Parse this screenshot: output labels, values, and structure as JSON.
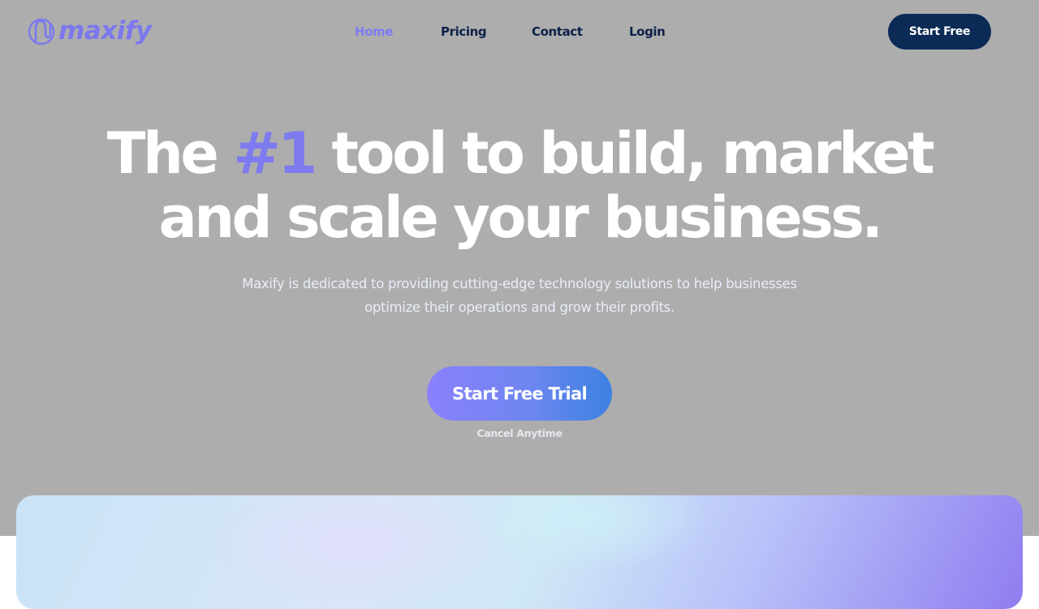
{
  "brand": {
    "name": "maxify",
    "color": "#7b78ee"
  },
  "nav": {
    "items": [
      {
        "label": "Home",
        "active": true
      },
      {
        "label": "Pricing",
        "active": false
      },
      {
        "label": "Contact",
        "active": false
      },
      {
        "label": "Login",
        "active": false
      }
    ],
    "cta_label": "Start Free"
  },
  "hero": {
    "headline_before": "The ",
    "headline_accent": "#1",
    "headline_after": " tool to build, market and scale your business.",
    "subtext": "Maxify is dedicated to providing cutting-edge technology solutions to help businesses optimize their operations and grow their profits.",
    "cta_label": "Start Free Trial",
    "cta_note": "Cancel Anytime"
  },
  "colors": {
    "hero_bg": "#adadad",
    "accent": "#7e7af0",
    "navy": "#0b2a55",
    "text_dark": "#0b2149"
  },
  "icons": {
    "logo": "maxify-logo-icon"
  }
}
